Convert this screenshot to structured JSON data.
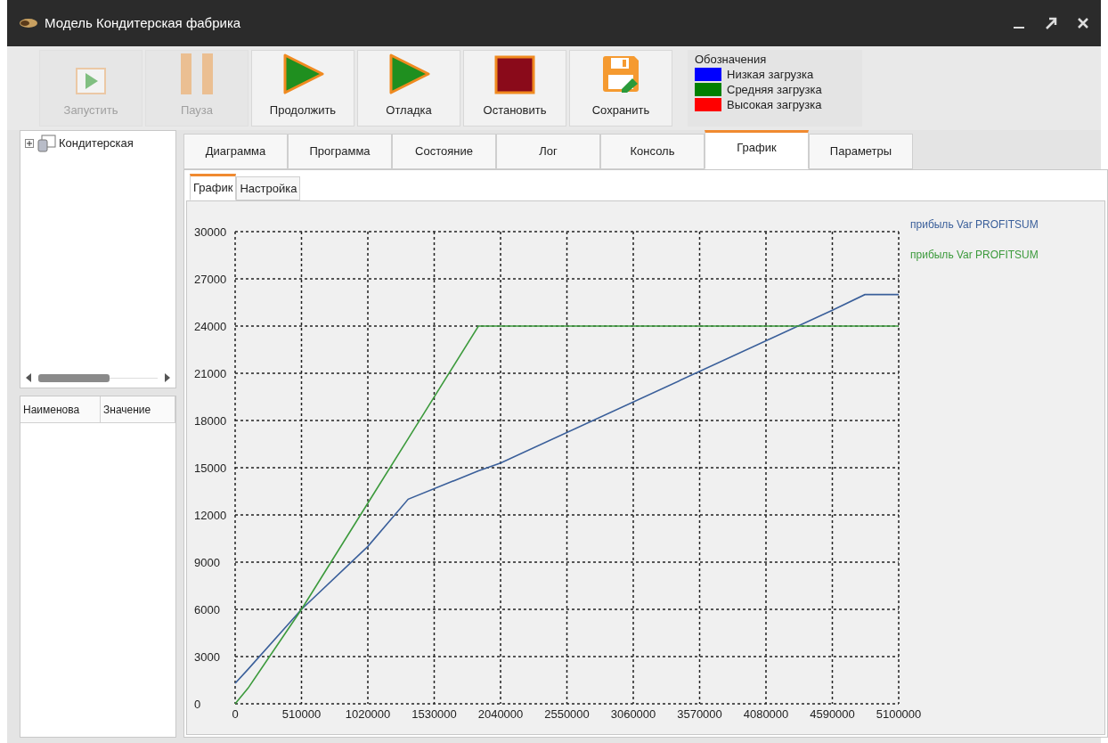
{
  "window": {
    "title": "Модель Кондитерская фабрика"
  },
  "toolbar": [
    {
      "label": "Запустить",
      "kind": "start",
      "disabled": true
    },
    {
      "label": "Пауза",
      "kind": "pause",
      "disabled": true
    },
    {
      "label": "Продолжить",
      "kind": "play",
      "disabled": false
    },
    {
      "label": "Отладка",
      "kind": "play",
      "disabled": false
    },
    {
      "label": "Остановить",
      "kind": "stop",
      "disabled": false
    },
    {
      "label": "Сохранить",
      "kind": "save",
      "disabled": false
    }
  ],
  "legend": {
    "title": "Обозначения",
    "items": [
      {
        "label": "Низкая загрузка",
        "color": "#0000ff"
      },
      {
        "label": "Средняя загрузка",
        "color": "#008000"
      },
      {
        "label": "Высокая загрузка",
        "color": "#ff0000"
      }
    ]
  },
  "tree": {
    "items": [
      {
        "label": "Кондитерская",
        "expanded": false
      }
    ]
  },
  "properties": {
    "columns": [
      "Наименова",
      "Значение"
    ]
  },
  "tabs": [
    {
      "label": "Диаграмма",
      "selected": false
    },
    {
      "label": "Программа",
      "selected": false
    },
    {
      "label": "Состояние",
      "selected": false
    },
    {
      "label": "Лог",
      "selected": false
    },
    {
      "label": "Консоль",
      "selected": false
    },
    {
      "label": "График",
      "selected": true
    },
    {
      "label": "Параметры",
      "selected": false
    }
  ],
  "subtabs": [
    {
      "label": "График",
      "selected": true
    },
    {
      "label": "Настройка",
      "selected": false
    }
  ],
  "chart_data": {
    "type": "line",
    "x": [
      0,
      100000,
      510000,
      1020000,
      1330000,
      1870000,
      2040000,
      4590000,
      4840000,
      5100000
    ],
    "series": [
      {
        "name": "прибыль Var PROFITSUM",
        "color": "#3a5f9a",
        "values": [
          1300,
          2200,
          6000,
          10000,
          13000,
          14800,
          15300,
          25000,
          26000,
          26000
        ]
      },
      {
        "name": "прибыль Var PROFITSUM",
        "color": "#3c9a3c",
        "values": [
          0,
          1000,
          6000,
          12750,
          16850,
          24000,
          24000,
          24000,
          24000,
          24000
        ]
      }
    ],
    "grid": true,
    "xlim": [
      0,
      5100000
    ],
    "ylim": [
      0,
      30000
    ],
    "xticks": [
      0,
      510000,
      1020000,
      1530000,
      2040000,
      2550000,
      3060000,
      3570000,
      4080000,
      4590000,
      5100000
    ],
    "yticks": [
      0,
      3000,
      6000,
      9000,
      12000,
      15000,
      18000,
      21000,
      24000,
      27000,
      30000
    ]
  }
}
